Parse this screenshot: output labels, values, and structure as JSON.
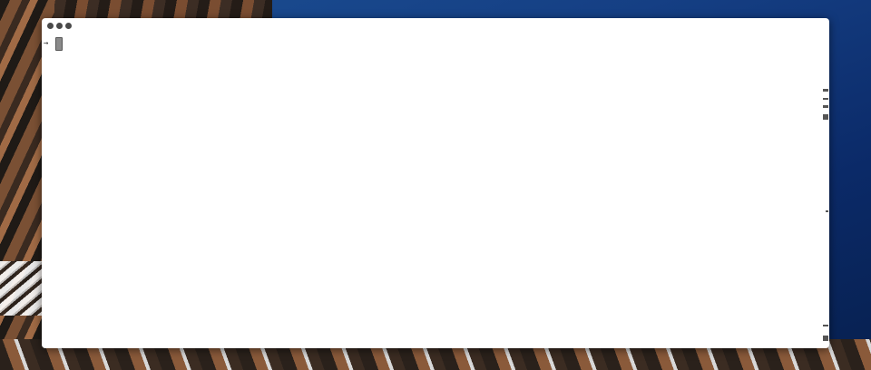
{
  "window": {
    "type": "terminal",
    "title": ""
  },
  "terminal": {
    "prompt_symbol": "→",
    "input_text": ""
  },
  "icons": {
    "close": "close-dot-icon",
    "minimize": "minimize-dot-icon",
    "zoom": "zoom-dot-icon",
    "prompt": "prompt-arrow-icon"
  },
  "colors": {
    "window_background": "#ffffff",
    "traffic_lights": "#4a4a4a",
    "cursor": "#8a8a8a",
    "desktop_background": "#153f84"
  }
}
